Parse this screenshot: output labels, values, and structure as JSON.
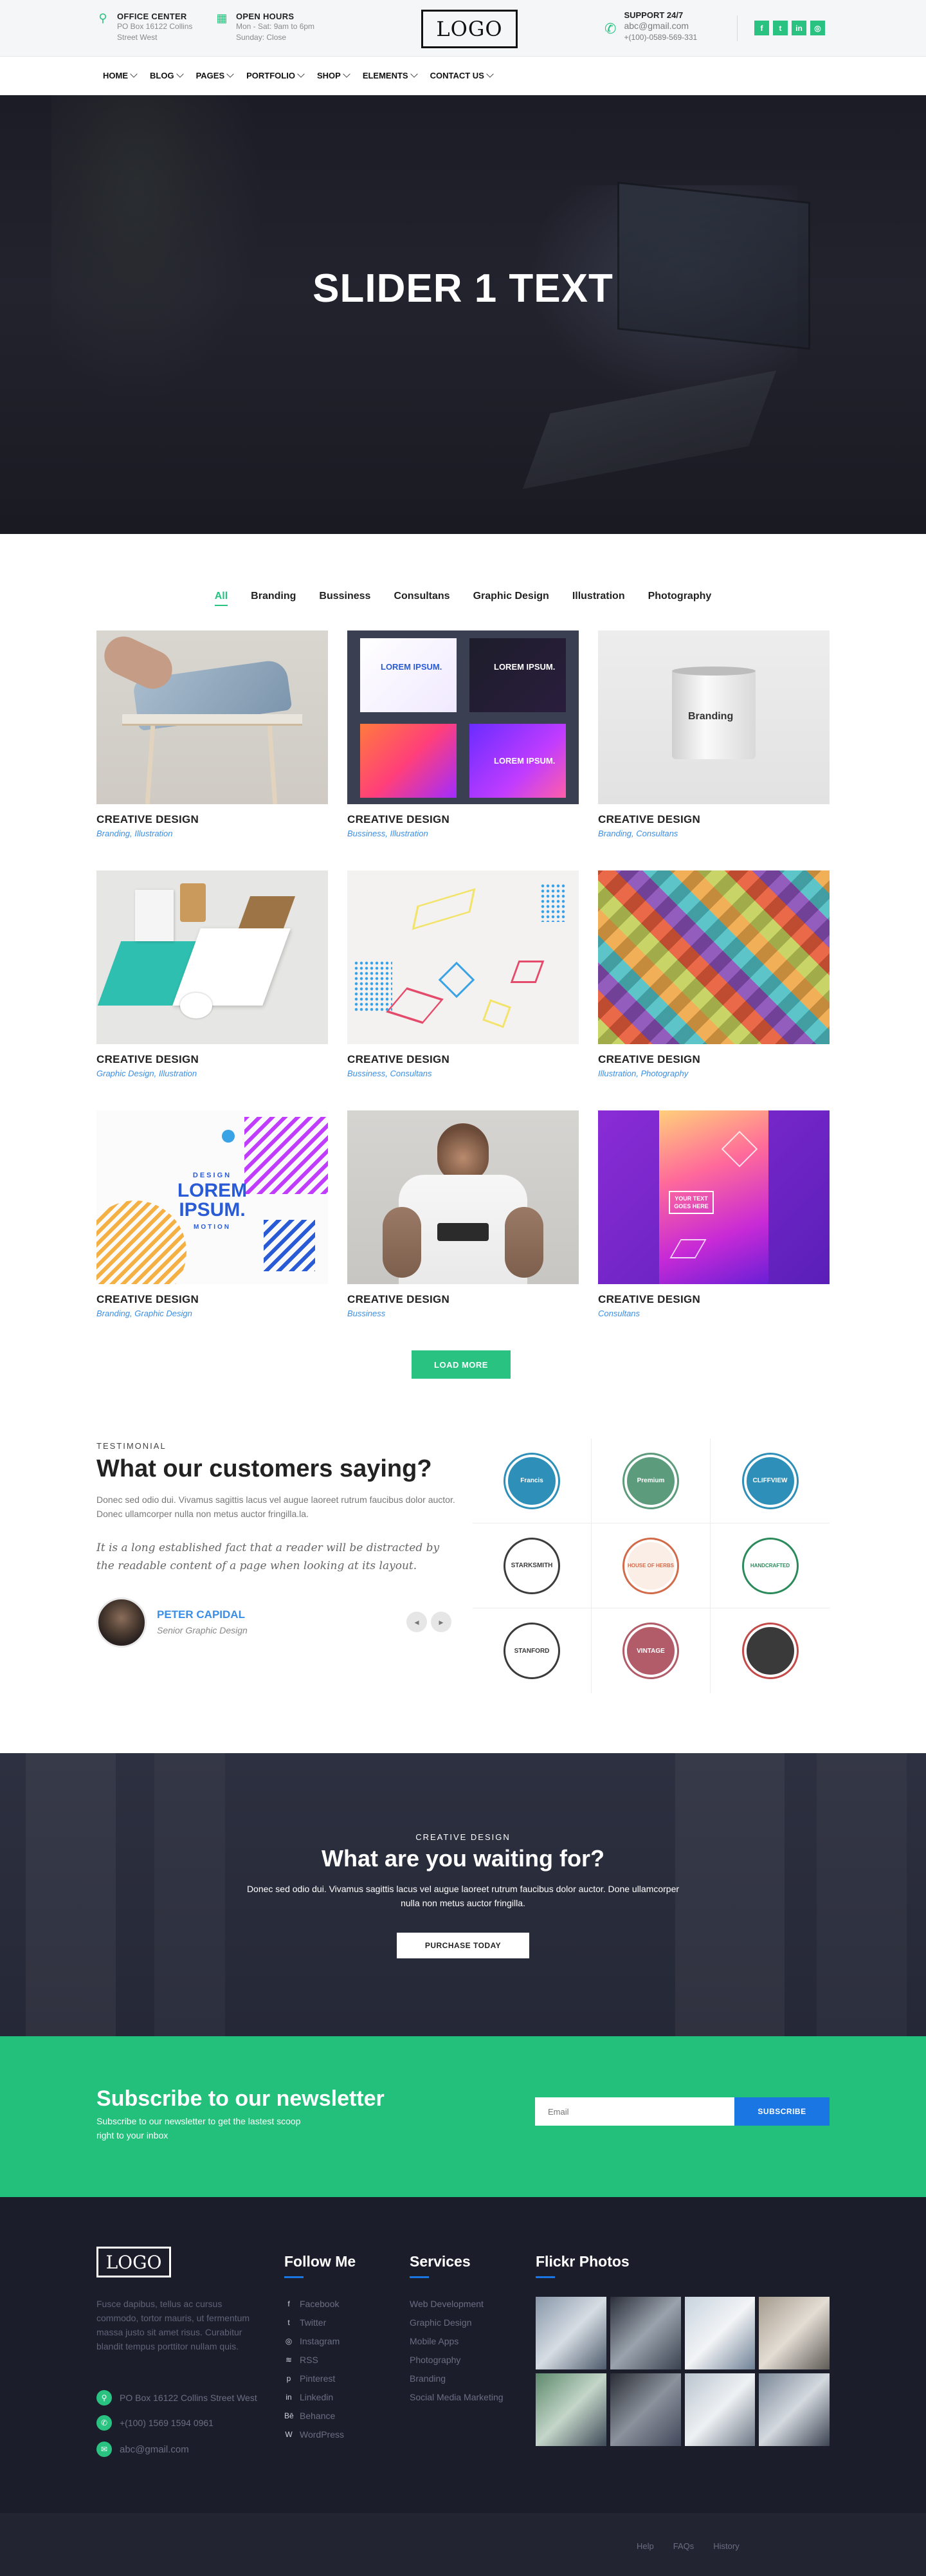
{
  "topbar": {
    "office": {
      "title": "OFFICE CENTER",
      "line1": "PO Box 16122 Collins",
      "line2": "Street West",
      "icon": "person-pin-icon"
    },
    "hours": {
      "title": "OPEN HOURS",
      "line1": "Mon - Sat: 9am to 6pm",
      "line2": "Sunday: Close",
      "icon": "calendar-icon"
    },
    "logo": "LOGO",
    "support": {
      "title": "SUPPORT 24/7",
      "email": "abc@gmail.com",
      "phone": "+(100)-0589-569-331",
      "icon": "phone-icon"
    },
    "social": [
      {
        "glyph": "f",
        "icon": "facebook-icon"
      },
      {
        "glyph": "t",
        "icon": "twitter-icon"
      },
      {
        "glyph": "in",
        "icon": "linkedin-icon"
      },
      {
        "glyph": "◎",
        "icon": "instagram-icon"
      }
    ]
  },
  "nav": {
    "items": [
      "HOME",
      "BLOG",
      "PAGES",
      "PORTFOLIO",
      "SHOP",
      "ELEMENTS",
      "CONTACT US"
    ]
  },
  "hero": {
    "title": "SLIDER 1 TEXT"
  },
  "filters": {
    "items": [
      "All",
      "Branding",
      "Bussiness",
      "Consultans",
      "Graphic Design",
      "Illustration",
      "Photography"
    ],
    "active": "All"
  },
  "portfolio": {
    "items": [
      {
        "title": "CREATIVE DESIGN",
        "cats": "Branding, Illustration"
      },
      {
        "title": "CREATIVE DESIGN",
        "cats": "Bussiness, Illustration"
      },
      {
        "title": "CREATIVE DESIGN",
        "cats": "Branding, Consultans"
      },
      {
        "title": "CREATIVE DESIGN",
        "cats": "Graphic Design, Illustration"
      },
      {
        "title": "CREATIVE DESIGN",
        "cats": "Bussiness, Consultans"
      },
      {
        "title": "CREATIVE DESIGN",
        "cats": "Illustration, Photography"
      },
      {
        "title": "CREATIVE DESIGN",
        "cats": "Branding, Graphic Design"
      },
      {
        "title": "CREATIVE DESIGN",
        "cats": "Bussiness"
      },
      {
        "title": "CREATIVE DESIGN",
        "cats": "Consultans"
      }
    ],
    "thumb_text": {
      "lorem": "LOREM IPSUM.",
      "branding": "Branding",
      "design": "DESIGN",
      "motion": "MOTION",
      "your_text": "YOUR TEXT GOES HERE"
    },
    "load_more": "LOAD MORE"
  },
  "testimonial": {
    "label": "TESTIMONIAL",
    "heading": "What our customers saying?",
    "text": "Donec sed odio dui. Vivamus sagittis lacus vel augue laoreet rutrum faucibus dolor auctor. Donec ullamcorper nulla non metus auctor fringilla.la.",
    "quote": "It is a long established fact that a reader will be distracted by the readable content of a page when looking at its layout.",
    "name": "PETER CAPIDAL",
    "role": "Senior Graphic Design"
  },
  "clients": [
    {
      "label": "Francis",
      "color": "#2e8fb8"
    },
    {
      "label": "Premium",
      "color": "#5c9c7c"
    },
    {
      "label": "CLIFFVIEW",
      "color": "#2e8fb8"
    },
    {
      "label": "STARKSMITH",
      "color": "#3c3c3c"
    },
    {
      "label": "HOUSE OF HERBS",
      "color": "#d26b4a"
    },
    {
      "label": "HANDCRAFTED",
      "color": "#2a8a5a"
    },
    {
      "label": "STANFORD",
      "color": "#3a3a3a"
    },
    {
      "label": "VINTAGE",
      "color": "#b25c6a"
    },
    {
      "label": "",
      "color": "#c44a4a"
    }
  ],
  "cta": {
    "sub": "CREATIVE DESIGN",
    "heading": "What are you waiting for?",
    "text": "Donec sed odio dui. Vivamus sagittis lacus vel augue laoreet rutrum faucibus dolor auctor. Done ullamcorper nulla non metus auctor fringilla.",
    "button": "PURCHASE TODAY"
  },
  "newsletter": {
    "heading": "Subscribe to our newsletter",
    "text": "Subscribe to our newsletter to get the lastest scoop right to your inbox",
    "placeholder": "Email",
    "button": "SUBSCRIBE"
  },
  "footer": {
    "logo": "LOGO",
    "about": "Fusce dapibus, tellus ac cursus commodo, tortor mauris, ut fermentum massa justo sit amet risus. Curabitur blandit tempus porttitor nullam quis.",
    "address": "PO Box 16122 Collins Street West",
    "phone": "+(100) 1569 1594 0961",
    "email": "abc@gmail.com",
    "follow_heading": "Follow Me",
    "follow": [
      {
        "label": "Facebook",
        "glyph": "f"
      },
      {
        "label": "Twitter",
        "glyph": "t"
      },
      {
        "label": "Instagram",
        "glyph": "◎"
      },
      {
        "label": "RSS",
        "glyph": "≋"
      },
      {
        "label": "Pinterest",
        "glyph": "p"
      },
      {
        "label": "Linkedin",
        "glyph": "in"
      },
      {
        "label": "Behance",
        "glyph": "Bē"
      },
      {
        "label": "WordPress",
        "glyph": "W"
      }
    ],
    "services_heading": "Services",
    "services": [
      "Web Development",
      "Graphic Design",
      "Mobile Apps",
      "Photography",
      "Branding",
      "Social Media Marketing"
    ],
    "flickr_heading": "Flickr Photos",
    "bottom_links": [
      "Help",
      "FAQs",
      "History"
    ]
  },
  "colors": {
    "accent": "#2ac281",
    "blue": "#1976e3",
    "dark": "#1c1d2b"
  }
}
